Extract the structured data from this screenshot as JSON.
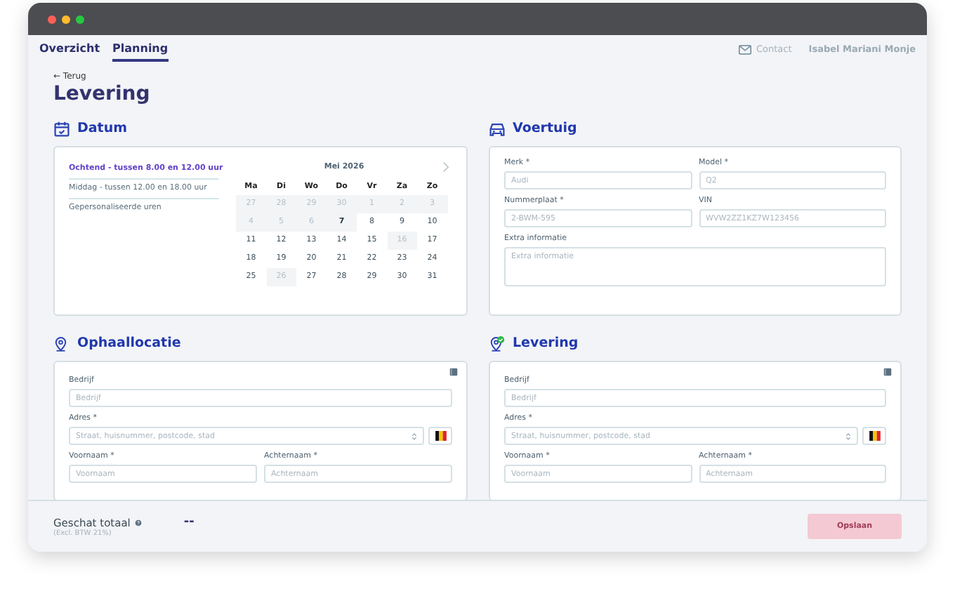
{
  "nav": {
    "tabs": [
      {
        "label": "Overzicht",
        "selected": false
      },
      {
        "label": "Planning",
        "selected": true
      }
    ],
    "contact": "Contact",
    "user": "Isabel Mariani Monje"
  },
  "back": "← Terug",
  "title": "Levering",
  "date": {
    "heading": "Datum",
    "slots": [
      {
        "label": "Ochtend - tussen 8.00 en 12.00 uur",
        "selected": true
      },
      {
        "label": "Middag - tussen 12.00 en 18.00 uur",
        "selected": false
      },
      {
        "label": "Gepersonaliseerde uren",
        "selected": false
      }
    ],
    "month": "Mei 2026",
    "weekdays": [
      "Ma",
      "Di",
      "Wo",
      "Do",
      "Vr",
      "Za",
      "Zo"
    ],
    "days": [
      {
        "label": "27",
        "kind": "disabled"
      },
      {
        "label": "28",
        "kind": "disabled"
      },
      {
        "label": "29",
        "kind": "disabled"
      },
      {
        "label": "30",
        "kind": "disabled"
      },
      {
        "label": "1",
        "kind": "disabled"
      },
      {
        "label": "2",
        "kind": "disabled"
      },
      {
        "label": "3",
        "kind": "disabled"
      },
      {
        "label": "4",
        "kind": "disabled"
      },
      {
        "label": "5",
        "kind": "disabled"
      },
      {
        "label": "6",
        "kind": "disabled"
      },
      {
        "label": "7",
        "kind": "today"
      },
      {
        "label": "8",
        "kind": "normal"
      },
      {
        "label": "9",
        "kind": "normal"
      },
      {
        "label": "10",
        "kind": "normal"
      },
      {
        "label": "11",
        "kind": "normal"
      },
      {
        "label": "12",
        "kind": "normal"
      },
      {
        "label": "13",
        "kind": "normal"
      },
      {
        "label": "14",
        "kind": "normal"
      },
      {
        "label": "15",
        "kind": "normal"
      },
      {
        "label": "16",
        "kind": "disabled"
      },
      {
        "label": "17",
        "kind": "normal"
      },
      {
        "label": "18",
        "kind": "normal"
      },
      {
        "label": "19",
        "kind": "normal"
      },
      {
        "label": "20",
        "kind": "normal"
      },
      {
        "label": "21",
        "kind": "normal"
      },
      {
        "label": "22",
        "kind": "normal"
      },
      {
        "label": "23",
        "kind": "normal"
      },
      {
        "label": "24",
        "kind": "normal"
      },
      {
        "label": "25",
        "kind": "normal"
      },
      {
        "label": "26",
        "kind": "disabled"
      },
      {
        "label": "27",
        "kind": "normal"
      },
      {
        "label": "28",
        "kind": "normal"
      },
      {
        "label": "29",
        "kind": "normal"
      },
      {
        "label": "30",
        "kind": "normal"
      },
      {
        "label": "31",
        "kind": "normal"
      }
    ]
  },
  "vehicle": {
    "heading": "Voertuig",
    "fields": [
      {
        "label": "Merk *",
        "placeholder": "Audi",
        "kind": "half"
      },
      {
        "label": "Model *",
        "placeholder": "Q2",
        "kind": "half"
      },
      {
        "label": "Nummerplaat *",
        "placeholder": "2-BWM-595",
        "kind": "half"
      },
      {
        "label": "VIN",
        "placeholder": "WVW2ZZ1KZ7W123456",
        "kind": "half"
      },
      {
        "label": "Extra informatie",
        "placeholder": "Extra informatie",
        "kind": "area"
      }
    ]
  },
  "locations": [
    {
      "heading": "Ophaallocatie",
      "confirmed": false,
      "fields": [
        {
          "label": "Bedrijf",
          "placeholder": "Bedrijf",
          "kind": "full"
        },
        {
          "label": "Adres *",
          "placeholder": "Straat, huisnummer, postcode, stad",
          "kind": "address"
        },
        {
          "label": "Voornaam *",
          "placeholder": "Voornaam",
          "kind": "half"
        },
        {
          "label": "Achternaam *",
          "placeholder": "Achternaam",
          "kind": "half"
        }
      ]
    },
    {
      "heading": "Levering",
      "confirmed": true,
      "fields": [
        {
          "label": "Bedrijf",
          "placeholder": "Bedrijf",
          "kind": "full"
        },
        {
          "label": "Adres *",
          "placeholder": "Straat, huisnummer, postcode, stad",
          "kind": "address"
        },
        {
          "label": "Voornaam *",
          "placeholder": "Voornaam",
          "kind": "half"
        },
        {
          "label": "Achternaam *",
          "placeholder": "Achternaam",
          "kind": "half"
        }
      ]
    }
  ],
  "footer": {
    "label": "Geschat totaal",
    "note": "(Excl. BTW 21%)",
    "total": "--",
    "button": {
      "label": "Opslaan",
      "disabled": true
    }
  }
}
